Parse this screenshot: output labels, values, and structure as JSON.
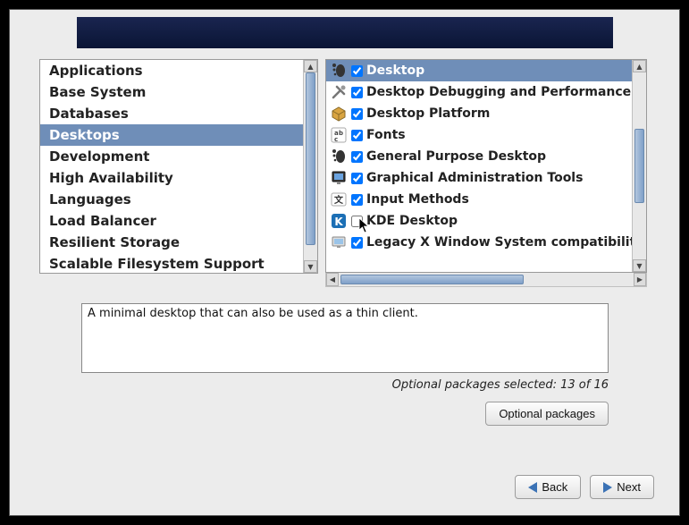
{
  "categories": {
    "items": [
      {
        "label": "Applications",
        "selected": false
      },
      {
        "label": "Base System",
        "selected": false
      },
      {
        "label": "Databases",
        "selected": false
      },
      {
        "label": "Desktops",
        "selected": true
      },
      {
        "label": "Development",
        "selected": false
      },
      {
        "label": "High Availability",
        "selected": false
      },
      {
        "label": "Languages",
        "selected": false
      },
      {
        "label": "Load Balancer",
        "selected": false
      },
      {
        "label": "Resilient Storage",
        "selected": false
      },
      {
        "label": "Scalable Filesystem Support",
        "selected": false
      }
    ]
  },
  "packages": {
    "items": [
      {
        "label": "Desktop",
        "checked": true,
        "selected": true,
        "icon": "gnome-foot-icon"
      },
      {
        "label": "Desktop Debugging and Performance",
        "checked": true,
        "selected": false,
        "icon": "tools-icon"
      },
      {
        "label": "Desktop Platform",
        "checked": true,
        "selected": false,
        "icon": "package-icon"
      },
      {
        "label": "Fonts",
        "checked": true,
        "selected": false,
        "icon": "fonts-icon"
      },
      {
        "label": "General Purpose Desktop",
        "checked": true,
        "selected": false,
        "icon": "gnome-foot-icon"
      },
      {
        "label": "Graphical Administration Tools",
        "checked": true,
        "selected": false,
        "icon": "admin-icon"
      },
      {
        "label": "Input Methods",
        "checked": true,
        "selected": false,
        "icon": "input-icon"
      },
      {
        "label": "KDE Desktop",
        "checked": false,
        "selected": false,
        "icon": "kde-icon"
      },
      {
        "label": "Legacy X Window System compatibility",
        "checked": true,
        "selected": false,
        "icon": "monitor-icon"
      }
    ]
  },
  "description": {
    "text": "A minimal desktop that can also be used as a thin client."
  },
  "status": {
    "text": "Optional packages selected: 13 of 16"
  },
  "buttons": {
    "optional_packages": "Optional packages",
    "back": "Back",
    "next": "Next"
  }
}
